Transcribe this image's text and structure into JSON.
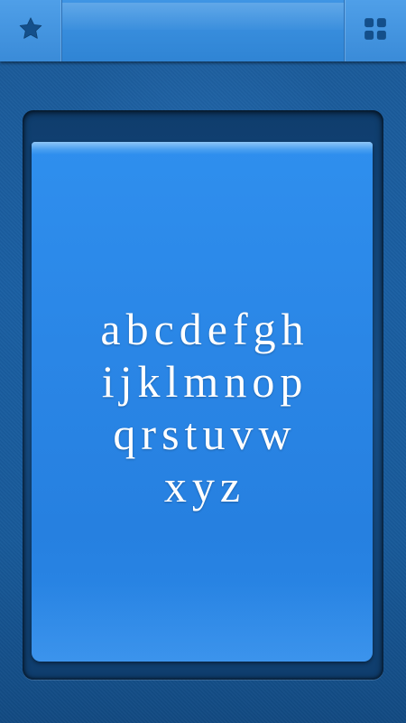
{
  "toolbar": {
    "left_icon": "star-icon",
    "right_icon": "grid-icon"
  },
  "card": {
    "rows": [
      [
        "a",
        "b",
        "c",
        "d",
        "e",
        "f",
        "g",
        "h"
      ],
      [
        "i",
        "j",
        "k",
        "l",
        "m",
        "n",
        "o",
        "p"
      ],
      [
        "q",
        "r",
        "s",
        "t",
        "u",
        "v",
        "w"
      ],
      [
        "x",
        "y",
        "z"
      ]
    ]
  },
  "colors": {
    "topbar": "#3f93e0",
    "card": "#2a86e6",
    "background": "#1a5fa3",
    "letters": "#ffffff"
  }
}
